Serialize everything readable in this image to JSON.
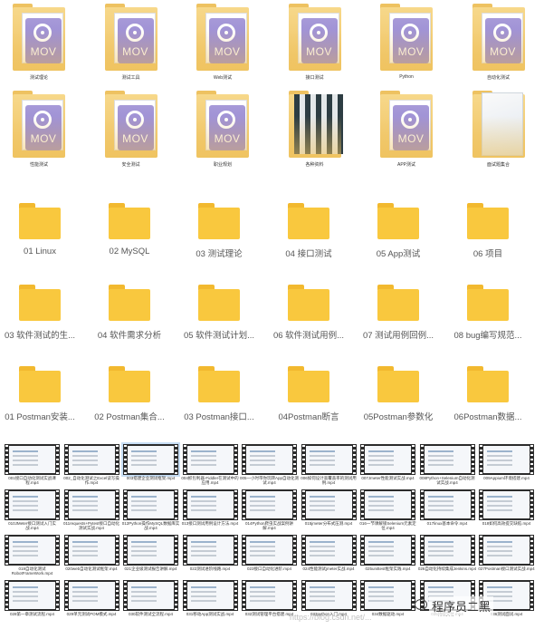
{
  "mov_folders": [
    {
      "label": "测试理论",
      "type": "mov"
    },
    {
      "label": "测试工具",
      "type": "mov"
    },
    {
      "label": "Web测试",
      "type": "mov"
    },
    {
      "label": "接口测试",
      "type": "mov"
    },
    {
      "label": "Python",
      "type": "mov"
    },
    {
      "label": "自动化测试",
      "type": "mov"
    },
    {
      "label": "性能测试",
      "type": "mov"
    },
    {
      "label": "安全测试",
      "type": "mov"
    },
    {
      "label": "职业规划",
      "type": "mov"
    },
    {
      "label": "各种资料",
      "type": "mixed"
    },
    {
      "label": "APP测试",
      "type": "mov"
    },
    {
      "label": "面试题集合",
      "type": "doc"
    }
  ],
  "mov_badge_text": "MOV",
  "folders": [
    "01 Linux",
    "02 MySQL",
    "03 测试理论",
    "04 接口测试",
    "05 App测试",
    "06 项目",
    "03 软件测试的生...",
    "04 软件需求分析",
    "05 软件测试计划...",
    "06 软件测试用例...",
    "07 测试用例回例...",
    "08 bug编写规范...",
    "01 Postman安装...",
    "02 Postman集合...",
    "03 Postman接口...",
    "04Postman断言",
    "05Postman参数化",
    "06Postman数据..."
  ],
  "videos": [
    "001接口自动化测试实战课程.mp4",
    "002_自动化测试之Excel读写操作.mp4",
    "003搭建企业测试框架.mp4",
    "004抓包利器-Fiddler在测试中的应用.mp4",
    "005一小时带你玩转App自动化测试.mp4",
    "006如何设计高覆盖率的测试用例.mp4",
    "007Jmeter性能测试实战.mp4",
    "008Python+Selenium自动化测试实战.mp4",
    "009Appium环境搭建.mp4",
    "010JMeter接口测试入门实战.mp4",
    "011requests+Pytest接口自动化测试实战.mp4",
    "012Python操作MySQL数据库实战.mp4",
    "013接口测试用例设计方法.mp4",
    "014Python爬虫实战案例讲解.mp4",
    "015jmeter分布式压测.mp4",
    "016一节课解锁Selenium元素定位.mp4",
    "017linux基本命令.mp4",
    "018如何高效提交缺陷.mp4",
    "019自动化测试RobotFrameWork.mp4",
    "020web自动化测试框架.mp4",
    "021企业级测试报告讲解.mp4",
    "022测试进阶线路.mp4",
    "023接口自动化进阶.mp4",
    "024性能测试jmeter实战.mp4",
    "025unittest框架实践.mp4",
    "026自动化持续集成Jenkins.mp4",
    "027Postman接口测试实战.mp4",
    "028第一章测试流程.mp4",
    "029单元测试POM模式.mp4",
    "030软件测试全流程.mp4",
    "031移动App测试实战.mp4",
    "032测试管理平台搭建.mp4",
    "033python入门.mp4",
    "034数据驱动.mp4",
    "035持续交付.mp4",
    "036测试面试.mp4"
  ],
  "watermark": "程序员二黑",
  "url_watermark": "https://blog.csdn.net/...",
  "colors": {
    "folder": "#f9c83e",
    "mov_badge": "#8e7fd0"
  }
}
